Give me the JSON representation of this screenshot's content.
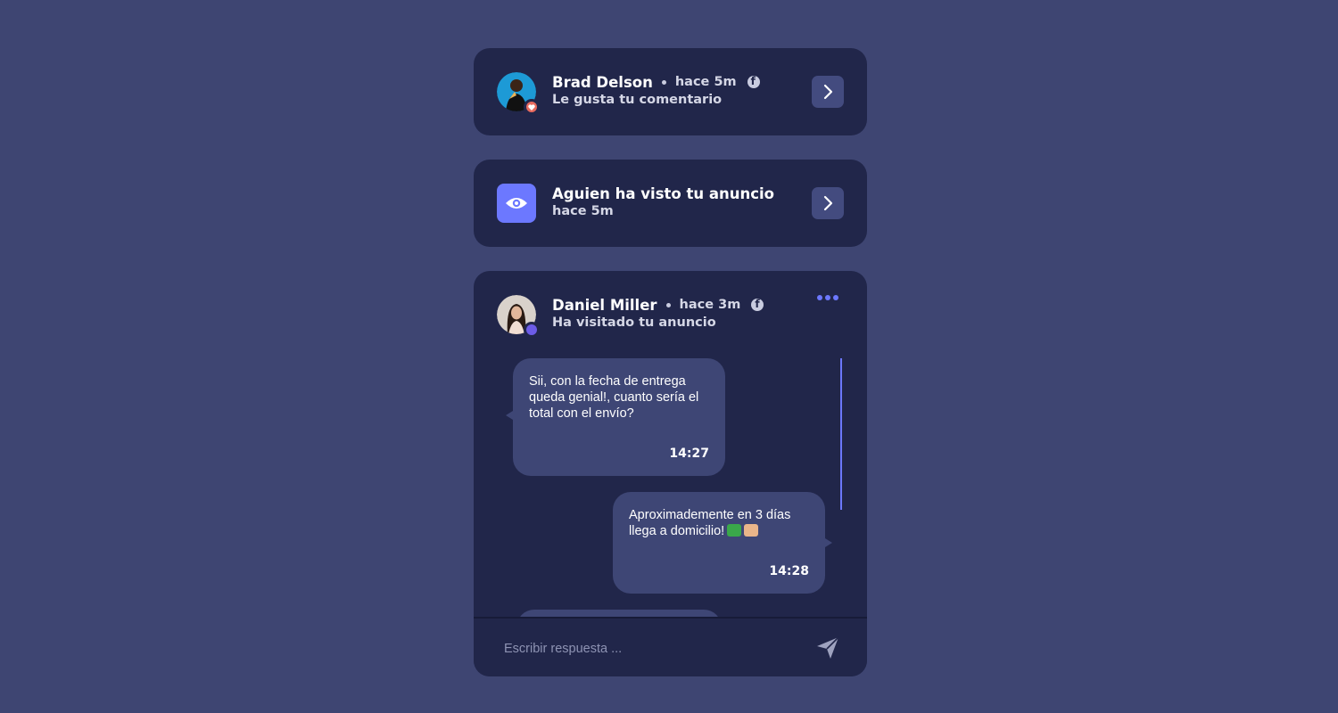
{
  "notifications": [
    {
      "name": "Brad Delson",
      "time": "hace 5m",
      "subtitle": "Le gusta tu comentario",
      "badge_color": "#e86a5e"
    },
    {
      "title": "Aguien ha visto tu anuncio",
      "subtitle": "hace 5m",
      "icon": "eye-icon",
      "icon_color": "#6c78ff"
    }
  ],
  "chat": {
    "name": "Daniel Miller",
    "time": "hace 3m",
    "subtitle": "Ha visitado tu anuncio",
    "badge_color": "#6c5ce7",
    "messages": [
      {
        "text": "Sii, con la fecha de entrega queda genial!, cuanto sería el total con el envío?",
        "time": "14:27",
        "side": "left"
      },
      {
        "text": "Aproximademente en 3 días llega a domicilio!",
        "emojis": [
          "truck-emoji",
          "package-emoji"
        ],
        "time": "14:28",
        "side": "right"
      }
    ],
    "reply_placeholder": "Escribir respuesta ..."
  },
  "colors": {
    "background": "#3e4572",
    "card": "#21264a",
    "bubble": "#3e4675",
    "accent": "#6c78ff"
  }
}
